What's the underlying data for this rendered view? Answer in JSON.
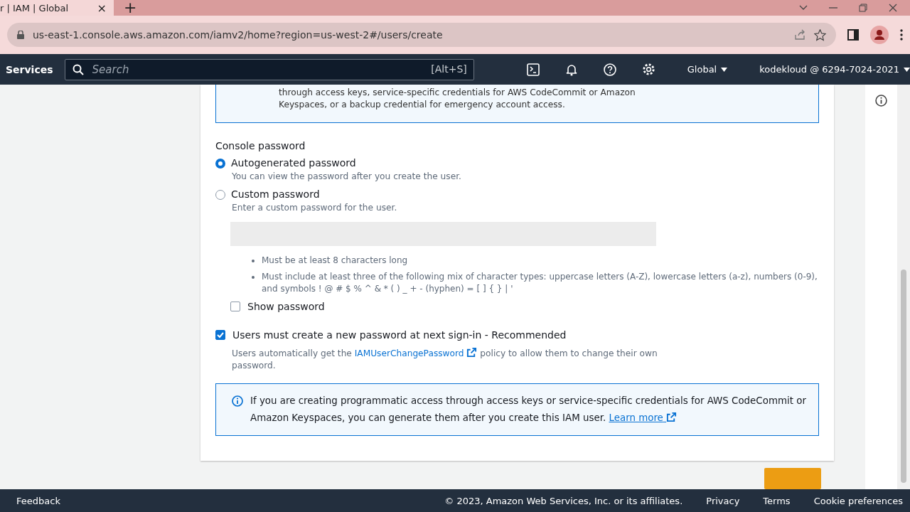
{
  "browser": {
    "tab": {
      "title": "r | IAM | Global",
      "close": "×"
    },
    "new_tab": "+",
    "url": "us-east-1.console.aws.amazon.com/iamv2/home?region=us-west-2#/users/create"
  },
  "aws_nav": {
    "services": "Services",
    "search": {
      "placeholder": "Search",
      "shortcut": "[Alt+S]"
    },
    "region": "Global",
    "account": "kodekloud @ 6294-7024-2021"
  },
  "top_alert": {
    "lines": [
      "through access keys, service-specific credentials for AWS CodeCommit or Amazon",
      "Keyspaces, or a backup credential for emergency account access."
    ]
  },
  "console_password": {
    "label": "Console password",
    "options": [
      {
        "label": "Autogenerated password",
        "description": "You can view the password after you create the user.",
        "selected": true
      },
      {
        "label": "Custom password",
        "description": "Enter a custom password for the user.",
        "selected": false
      }
    ],
    "password_field": {
      "disabled": true
    },
    "rules": [
      "Must be at least 8 characters long",
      "Must include at least three of the following mix of character types: uppercase letters (A-Z), lowercase letters (a-z), numbers (0-9), and symbols ! @ # $ % ^ & * ( ) _ + - (hyphen) = [ ] { } | '"
    ],
    "show_password": {
      "label": "Show password",
      "checked": false
    },
    "must_reset": {
      "label": "Users must create a new password at next sign-in - Recommended",
      "checked": true,
      "description_before": "Users automatically get the",
      "link": "IAMUserChangePassword",
      "description_after": "policy to allow them to change their own password."
    }
  },
  "info_alert": {
    "text": "If you are creating programmatic access through access keys or service-specific credentials for AWS CodeCommit or Amazon Keyspaces, you can generate them after you create this IAM user.",
    "link": "Learn more"
  },
  "footer": {
    "feedback": "Feedback",
    "copyright": "© 2023, Amazon Web Services, Inc. or its affiliates.",
    "links": [
      "Privacy",
      "Terms",
      "Cookie preferences"
    ]
  }
}
